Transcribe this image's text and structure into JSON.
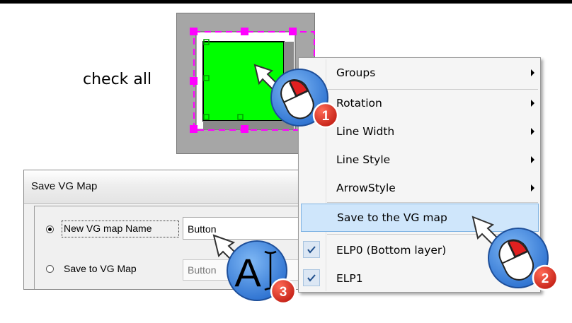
{
  "instruction": "check all",
  "dialog": {
    "title": "Save VG Map",
    "option_new_label": "New VG map Name",
    "option_new_selected": true,
    "name_value": "Button",
    "option_existing_label": "Save to VG Map",
    "option_existing_selected": false,
    "existing_value": "Button"
  },
  "menu": {
    "items": [
      {
        "label": "Groups",
        "submenu": true
      },
      {
        "label": "Rotation",
        "submenu": true
      },
      {
        "label": "Line Width",
        "submenu": true
      },
      {
        "label": "Line Style",
        "submenu": true
      },
      {
        "label": "ArrowStyle",
        "submenu": true
      },
      {
        "label": "Save to the VG map",
        "highlighted": true
      },
      {
        "label": "ELP0 (Bottom layer)",
        "checked": true
      },
      {
        "label": "ELP1",
        "checked": true
      }
    ]
  },
  "steps": [
    {
      "number": "1",
      "icon": "mouse-left-click-icon"
    },
    {
      "number": "2",
      "icon": "mouse-left-click-icon"
    },
    {
      "number": "3",
      "icon": "text-input-icon",
      "text": "A"
    }
  ],
  "colors": {
    "shape_fill": "#00ff00",
    "selection_handles": "#ff00ff",
    "menu_highlight": "#cfe6fb",
    "badge_red": "#d7261e",
    "cursor_circle": "#3a86e0"
  }
}
